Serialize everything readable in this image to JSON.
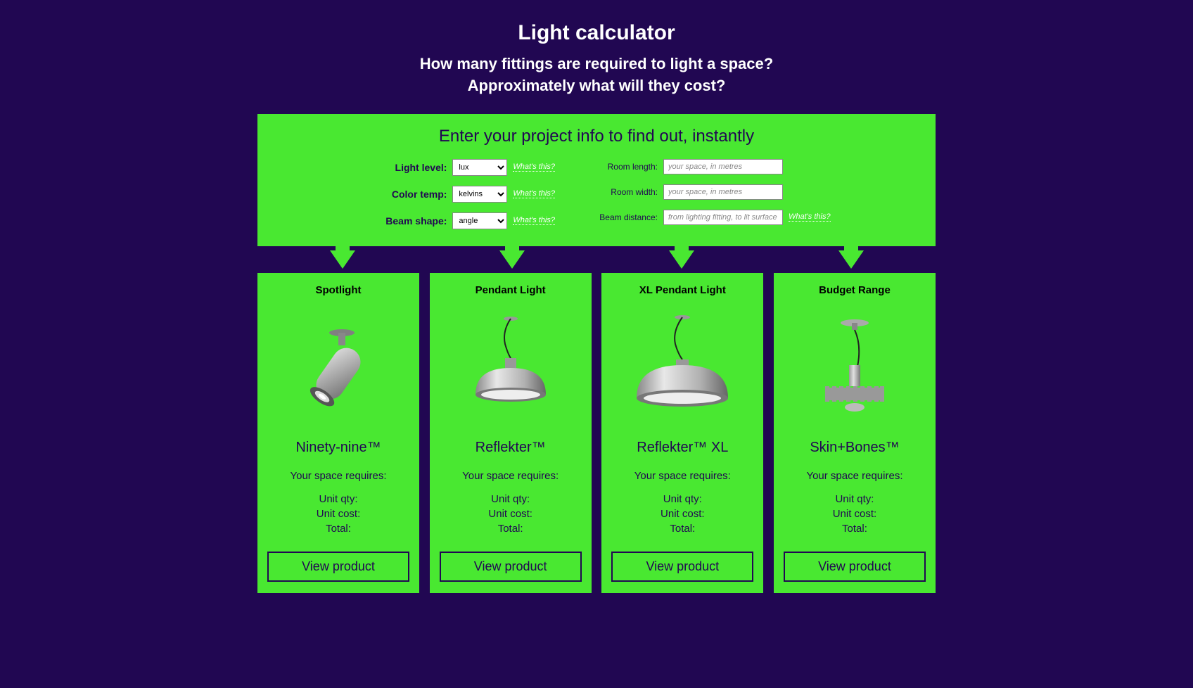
{
  "header": {
    "title": "Light calculator",
    "subtitle_line1": "How many fittings are required to light a space?",
    "subtitle_line2": "Approximately what will they cost?"
  },
  "form": {
    "heading": "Enter your project info to find out, instantly",
    "light_level_label": "Light level:",
    "light_level_value": "lux",
    "color_temp_label": "Color temp:",
    "color_temp_value": "kelvins",
    "beam_shape_label": "Beam shape:",
    "beam_shape_value": "angle",
    "room_length_label": "Room length:",
    "room_length_placeholder": "your space, in metres",
    "room_width_label": "Room width:",
    "room_width_placeholder": "your space, in metres",
    "beam_distance_label": "Beam distance:",
    "beam_distance_placeholder": "from lighting fitting, to lit surface",
    "help_text": "What's this?"
  },
  "cards": [
    {
      "type": "Spotlight",
      "name": "Ninety-nine™",
      "requires": "Your space requires:",
      "qty_label": "Unit qty:",
      "cost_label": "Unit cost:",
      "total_label": "Total:",
      "button": "View product"
    },
    {
      "type": "Pendant Light",
      "name": "Reflekter™",
      "requires": "Your space requires:",
      "qty_label": "Unit qty:",
      "cost_label": "Unit cost:",
      "total_label": "Total:",
      "button": "View product"
    },
    {
      "type": "XL Pendant Light",
      "name": "Reflekter™ XL",
      "requires": "Your space requires:",
      "qty_label": "Unit qty:",
      "cost_label": "Unit cost:",
      "total_label": "Total:",
      "button": "View product"
    },
    {
      "type": "Budget Range",
      "name": "Skin+Bones™",
      "requires": "Your space requires:",
      "qty_label": "Unit qty:",
      "cost_label": "Unit cost:",
      "total_label": "Total:",
      "button": "View product"
    }
  ]
}
